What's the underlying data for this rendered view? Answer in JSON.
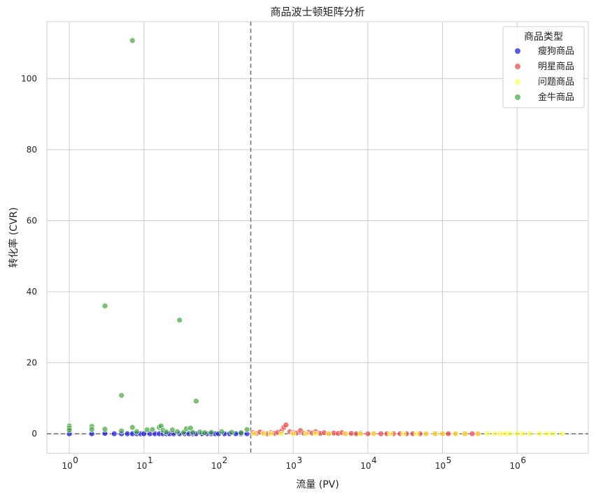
{
  "chart_data": {
    "type": "scatter",
    "title": "商品波士顿矩阵分析",
    "xlabel": "流量 (PV)",
    "ylabel": "转化率 (CVR)",
    "x_scale": "log",
    "xlim": [
      0.5,
      9000000
    ],
    "ylim": [
      -5.5,
      116
    ],
    "x_ticks": [
      {
        "value": 1,
        "base": "10",
        "exp": "0"
      },
      {
        "value": 10,
        "base": "10",
        "exp": "1"
      },
      {
        "value": 100,
        "base": "10",
        "exp": "2"
      },
      {
        "value": 1000,
        "base": "10",
        "exp": "3"
      },
      {
        "value": 10000,
        "base": "10",
        "exp": "4"
      },
      {
        "value": 100000,
        "base": "10",
        "exp": "5"
      },
      {
        "value": 1000000,
        "base": "10",
        "exp": "6"
      }
    ],
    "y_ticks": [
      0,
      20,
      40,
      60,
      80,
      100
    ],
    "grid": true,
    "threshold_x": 270,
    "threshold_y": 0,
    "legend": {
      "title": "商品类型",
      "position": "top-right"
    },
    "series": [
      {
        "name": "瘦狗商品",
        "color": "#0000dd",
        "points": [
          [
            1,
            0
          ],
          [
            2,
            0
          ],
          [
            3,
            0.1
          ],
          [
            4,
            0
          ],
          [
            5,
            0
          ],
          [
            6,
            0
          ],
          [
            7,
            0
          ],
          [
            8,
            0
          ],
          [
            9,
            0
          ],
          [
            10,
            0
          ],
          [
            12,
            0
          ],
          [
            14,
            0
          ],
          [
            16,
            0
          ],
          [
            18,
            0
          ],
          [
            20,
            0
          ],
          [
            22,
            0
          ],
          [
            25,
            0
          ],
          [
            30,
            0
          ],
          [
            35,
            0
          ],
          [
            40,
            0
          ],
          [
            45,
            0
          ],
          [
            50,
            0
          ],
          [
            60,
            0
          ],
          [
            70,
            0
          ],
          [
            80,
            0
          ],
          [
            90,
            0
          ],
          [
            100,
            0
          ],
          [
            120,
            0
          ],
          [
            140,
            0
          ],
          [
            170,
            0
          ],
          [
            200,
            0
          ],
          [
            240,
            0
          ]
        ]
      },
      {
        "name": "明星商品",
        "color": "#ee3333",
        "points": [
          [
            290,
            0.3
          ],
          [
            320,
            0.1
          ],
          [
            360,
            0.5
          ],
          [
            400,
            0.2
          ],
          [
            450,
            0
          ],
          [
            500,
            0.3
          ],
          [
            560,
            0.1
          ],
          [
            620,
            0.4
          ],
          [
            700,
            0.8
          ],
          [
            750,
            1.8
          ],
          [
            800,
            2.5
          ],
          [
            900,
            0.6
          ],
          [
            1000,
            0.3
          ],
          [
            1100,
            0.2
          ],
          [
            1250,
            0.9
          ],
          [
            1400,
            0.1
          ],
          [
            1600,
            0.4
          ],
          [
            1800,
            0.2
          ],
          [
            2000,
            0.6
          ],
          [
            2300,
            0.1
          ],
          [
            2600,
            0.3
          ],
          [
            3000,
            0
          ],
          [
            3500,
            0.2
          ],
          [
            4000,
            0.1
          ],
          [
            4500,
            0.3
          ],
          [
            5000,
            0
          ],
          [
            6000,
            0.1
          ],
          [
            7000,
            0
          ],
          [
            8000,
            0.2
          ],
          [
            10000,
            0
          ],
          [
            12000,
            0.1
          ],
          [
            15000,
            0
          ],
          [
            18000,
            0
          ],
          [
            22000,
            0
          ],
          [
            27000,
            0
          ],
          [
            33000,
            0
          ],
          [
            40000,
            0
          ],
          [
            50000,
            0
          ],
          [
            60000,
            0
          ],
          [
            80000,
            0
          ],
          [
            100000,
            0
          ],
          [
            120000,
            0
          ],
          [
            150000,
            0
          ],
          [
            200000,
            0
          ],
          [
            250000,
            0
          ],
          [
            300000,
            0
          ]
        ]
      },
      {
        "name": "问题商品",
        "color": "#ffff33",
        "points": [
          [
            300,
            0
          ],
          [
            400,
            0
          ],
          [
            500,
            0
          ],
          [
            700,
            0
          ],
          [
            1000,
            0
          ],
          [
            1500,
            0
          ],
          [
            2000,
            0
          ],
          [
            3000,
            0
          ],
          [
            5000,
            0
          ],
          [
            8000,
            0
          ],
          [
            12000,
            0
          ],
          [
            20000,
            0
          ],
          [
            30000,
            0
          ],
          [
            45000,
            0
          ],
          [
            60000,
            0
          ],
          [
            80000,
            0
          ],
          [
            100000,
            0
          ],
          [
            150000,
            0
          ],
          [
            200000,
            0
          ],
          [
            300000,
            0
          ],
          [
            400000,
            0
          ],
          [
            500000,
            0
          ],
          [
            600000,
            0
          ],
          [
            700000,
            0
          ],
          [
            800000,
            0
          ],
          [
            1000000,
            0
          ],
          [
            1200000,
            0
          ],
          [
            1500000,
            0
          ],
          [
            2000000,
            0
          ],
          [
            2500000,
            0
          ],
          [
            3000000,
            0
          ],
          [
            4000000,
            0
          ]
        ]
      },
      {
        "name": "金牛商品",
        "color": "#33a02c",
        "points": [
          [
            7,
            110.7
          ],
          [
            3,
            36
          ],
          [
            30,
            32
          ],
          [
            5,
            10.8
          ],
          [
            50,
            9.2
          ],
          [
            1,
            2.2
          ],
          [
            1,
            1.6
          ],
          [
            1,
            1.0
          ],
          [
            2,
            2.1
          ],
          [
            2,
            1.2
          ],
          [
            3,
            1.3
          ],
          [
            5,
            0.8
          ],
          [
            7,
            1.8
          ],
          [
            8,
            0.6
          ],
          [
            11,
            1.1
          ],
          [
            13,
            1.2
          ],
          [
            16,
            1.8
          ],
          [
            17,
            2.2
          ],
          [
            18,
            1.0
          ],
          [
            20,
            0.5
          ],
          [
            24,
            1.1
          ],
          [
            28,
            0.6
          ],
          [
            34,
            0.4
          ],
          [
            37,
            1.4
          ],
          [
            42,
            1.6
          ],
          [
            45,
            0.4
          ],
          [
            56,
            0.5
          ],
          [
            65,
            0.3
          ],
          [
            80,
            0.4
          ],
          [
            110,
            0.6
          ],
          [
            150,
            0.4
          ],
          [
            200,
            0.3
          ],
          [
            240,
            1.2
          ]
        ]
      }
    ]
  }
}
